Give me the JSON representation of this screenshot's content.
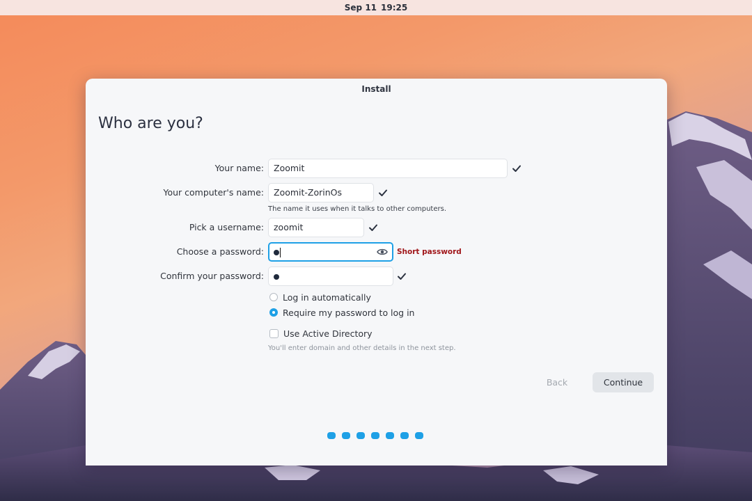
{
  "topbar": {
    "date": "Sep 11",
    "time": "19:25"
  },
  "window": {
    "title": "Install"
  },
  "page": {
    "title": "Who are you?"
  },
  "form": {
    "name_label": "Your name:",
    "name_value": "Zoomit",
    "computer_label": "Your computer's name:",
    "computer_value": "Zoomit-ZorinOs",
    "computer_hint": "The name it uses when it talks to other computers.",
    "username_label": "Pick a username:",
    "username_value": "zoomit",
    "password_label": "Choose a password:",
    "password_error": "Short password",
    "confirm_label": "Confirm your password:",
    "login_auto_label": "Log in automatically",
    "login_require_label": "Require my password to log in",
    "active_directory_label": "Use Active Directory",
    "active_directory_hint": "You'll enter domain and other details in the next step."
  },
  "buttons": {
    "back": "Back",
    "continue": "Continue"
  },
  "colors": {
    "accent": "#1ea0e6",
    "error": "#a0161a"
  },
  "icons": {
    "valid": "check-icon",
    "reveal": "eye-icon"
  }
}
